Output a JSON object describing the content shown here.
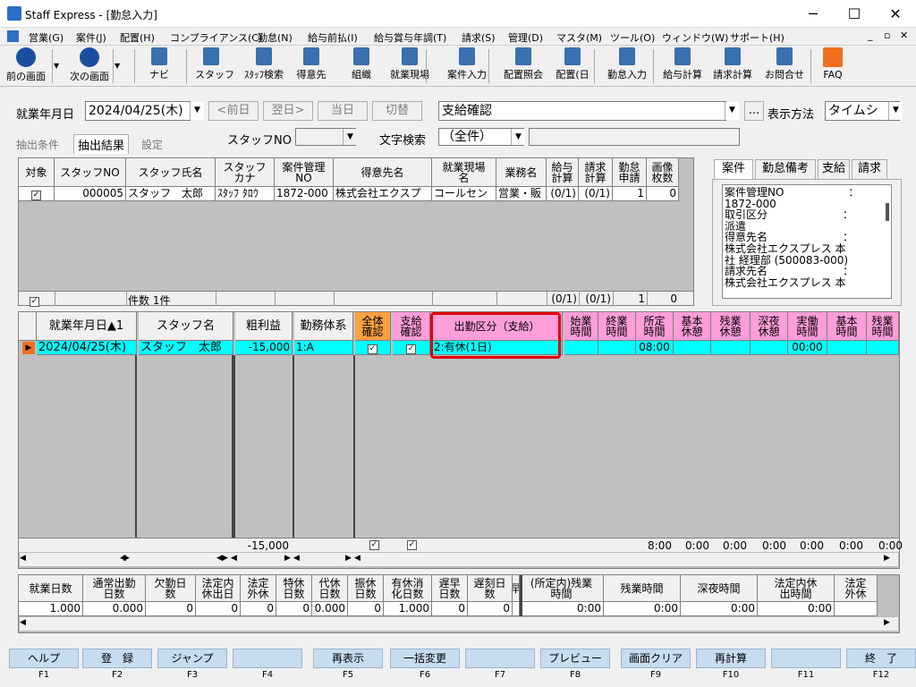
{
  "window": {
    "title": "Staff Express - [勤怠入力]"
  },
  "menu": [
    "営業(G)",
    "案件(J)",
    "配置(H)",
    "コンプライアンス(C)",
    "勤怠(N)",
    "給与前払(I)",
    "給与賞与年調(T)",
    "請求(S)",
    "管理(D)",
    "マスタ(M)",
    "ツール(O)",
    "ウィンドウ(W)",
    "サポート(H)"
  ],
  "toolbar": [
    "前の画面",
    "次の画面",
    "ナビ",
    "スタッフ",
    "ｽﾀｯﾌ検索",
    "得意先",
    "組織",
    "就業現場",
    "案件入力",
    "配置照会",
    "配置(日",
    "勤怠入力",
    "給与計算",
    "請求計算",
    "お問合せ",
    "FAQ"
  ],
  "filters": {
    "date_label": "就業年月日",
    "date_value": "2024/04/25(木)",
    "prev_month": "<前日",
    "next_month": "翌日>",
    "today": "当日",
    "toggle": "切替",
    "mode_value": "支給確認",
    "ellipsis": "...",
    "display_label": "表示方法",
    "display_value": "タイムシ",
    "staff_no_label": "スタッフNO",
    "text_search_label": "文字検索",
    "text_search_value": "（全件）"
  },
  "tabs_left": [
    "抽出条件",
    "抽出結果",
    "設定"
  ],
  "tabs_right": [
    "案件",
    "勤怠備考",
    "支給",
    "請求"
  ],
  "upper_grid": {
    "headers": [
      "対象",
      "スタッフNO",
      "スタッフ氏名",
      "スタッフ\nカナ",
      "案件管理\nNO",
      "得意先名",
      "就業現場\n名",
      "業務名",
      "給与\n計算",
      "請求\n計算",
      "勤怠\n申請",
      "画像\n枚数"
    ],
    "row": [
      "",
      "000005",
      "スタッフ　太郎",
      "ｽﾀｯﾌ ﾀﾛｳ",
      "1872-000",
      "株式会社エクスプ",
      "コールセン",
      "営業・販",
      "(0/1)",
      "(0/1)",
      "1",
      "0"
    ],
    "footer_count": "件数 1件",
    "footer": [
      "(0/1)",
      "(0/1)",
      "1",
      "0"
    ]
  },
  "info_panel": [
    "案件管理NO　　　　　　：",
    "1872-000",
    "取引区分　　　　　　　：",
    "派遣",
    "得意先名　　　　　　　：",
    "株式会社エクスプレス 本",
    "社 経理部 (500083-000)",
    "請求先名　　　　　　　：",
    "株式会社エクスプレス 本"
  ],
  "lower_grid": {
    "headers": [
      "就業年月日▲1",
      "スタッフ名",
      "粗利益",
      "勤務体系",
      "全体\n確認",
      "支給\n確認",
      "出勤区分（支給）",
      "始業\n時間",
      "終業\n時間",
      "所定\n時間",
      "基本\n休憩",
      "残業\n休憩",
      "深夜\n休憩",
      "実働\n時間",
      "基本\n時間",
      "残業\n時間"
    ],
    "row": [
      "2024/04/25(木)",
      "スタッフ　太郎",
      "-15,000",
      "1:A",
      "✓",
      "✓",
      "2:有休(1日)",
      "",
      "",
      "08:00",
      "",
      "",
      "",
      "00:00",
      "",
      ""
    ],
    "footer": [
      "-15,000",
      "8:00",
      "0:00",
      "0:00",
      "0:00",
      "0:00",
      "0:00",
      "0:00"
    ]
  },
  "summary": {
    "headers": [
      "就業日数",
      "通常出勤\n日数",
      "欠勤日\n数",
      "法定内\n休出日",
      "法定\n外休",
      "特休\n日数",
      "代休\n日数",
      "振休\n日数",
      "有休消\n化日数",
      "遅早\n日数",
      "遅刻日\n数",
      "早",
      "(所定内)残業\n時間",
      "残業時間",
      "深夜時間",
      "法定内休\n出時間",
      "法定\n外休"
    ],
    "values": [
      "1.000",
      "0.000",
      "0",
      "0",
      "0",
      "0",
      "0.000",
      "0",
      "1.000",
      "0",
      "0",
      "",
      "0:00",
      "0:00",
      "0:00",
      "0:00",
      ""
    ]
  },
  "fkeys": [
    {
      "label": "ヘルプ",
      "key": "F1"
    },
    {
      "label": "登　録",
      "key": "F2"
    },
    {
      "label": "ジャンプ",
      "key": "F3"
    },
    {
      "label": "",
      "key": "F4"
    },
    {
      "label": "再表示",
      "key": "F5"
    },
    {
      "label": "一括変更",
      "key": "F6"
    },
    {
      "label": "",
      "key": "F7"
    },
    {
      "label": "プレビュー",
      "key": "F8"
    },
    {
      "label": "画面クリア",
      "key": "F9"
    },
    {
      "label": "再計算",
      "key": "F10"
    },
    {
      "label": "",
      "key": "F11"
    },
    {
      "label": "終　了",
      "key": "F12"
    }
  ]
}
